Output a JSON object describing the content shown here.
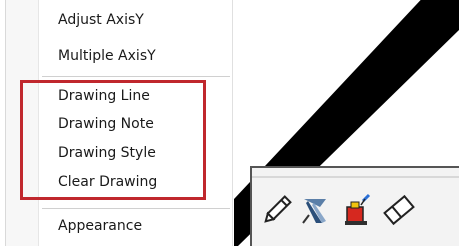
{
  "menu": {
    "items_top": [
      {
        "label": "Adjust AxisY"
      },
      {
        "label": "Multiple AxisY"
      }
    ],
    "items_drawing": [
      {
        "label": "Drawing Line"
      },
      {
        "label": "Drawing Note"
      },
      {
        "label": "Drawing Style"
      },
      {
        "label": "Clear Drawing"
      }
    ],
    "items_bottom": [
      {
        "label": "Appearance"
      }
    ]
  },
  "highlight_color": "#c0272d",
  "toolbar": {
    "buttons": [
      {
        "icon": "pencil-icon"
      },
      {
        "icon": "pin-note-icon"
      },
      {
        "icon": "paint-bucket-icon"
      },
      {
        "icon": "eraser-icon"
      }
    ]
  }
}
